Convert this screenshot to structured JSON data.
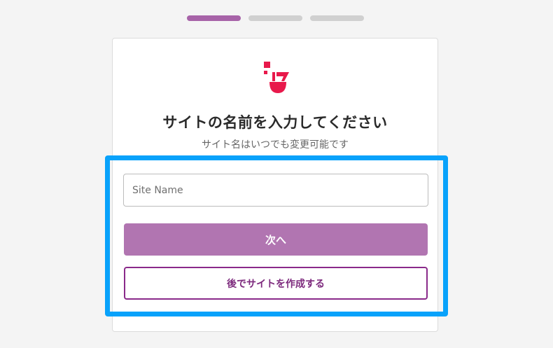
{
  "steps": [
    {
      "label": "",
      "active": true
    },
    {
      "label": "",
      "active": false
    },
    {
      "label": "",
      "active": false
    }
  ],
  "logo": {
    "icon": "brand-face-logo-icon",
    "color": "#e8194b"
  },
  "card": {
    "title": "サイトの名前を入力してください",
    "subtitle": "サイト名はいつでも変更可能です"
  },
  "form": {
    "site_name": {
      "placeholder": "Site Name",
      "value": ""
    },
    "next_label": "次へ",
    "later_label": "後でサイトを作成する"
  },
  "colors": {
    "accent": "#b175b1",
    "accent_dark": "#8a2a8a",
    "highlight": "#08a2fb",
    "brand": "#e8194b"
  }
}
